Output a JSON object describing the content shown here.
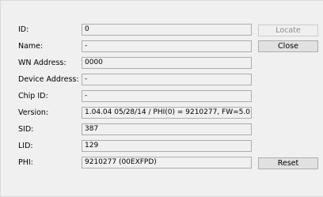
{
  "fields": {
    "id": {
      "label": "ID:",
      "value": "0"
    },
    "name": {
      "label": "Name:",
      "value": "-"
    },
    "wn_address": {
      "label": "WN Address:",
      "value": "0000"
    },
    "device_address": {
      "label": "Device Address:",
      "value": "-"
    },
    "chip_id": {
      "label": "Chip ID:",
      "value": "-"
    },
    "version": {
      "label": "Version:",
      "value": "1.04.04 05/28/14 / PHI(0) = 9210277, FW=5.0"
    },
    "sid": {
      "label": "SID:",
      "value": "387"
    },
    "lid": {
      "label": "LID:",
      "value": "129"
    },
    "phi": {
      "label": "PHI:",
      "value": "9210277 (00EXFPD)"
    }
  },
  "buttons": {
    "locate": "Locate",
    "close": "Close",
    "reset": "Reset"
  }
}
